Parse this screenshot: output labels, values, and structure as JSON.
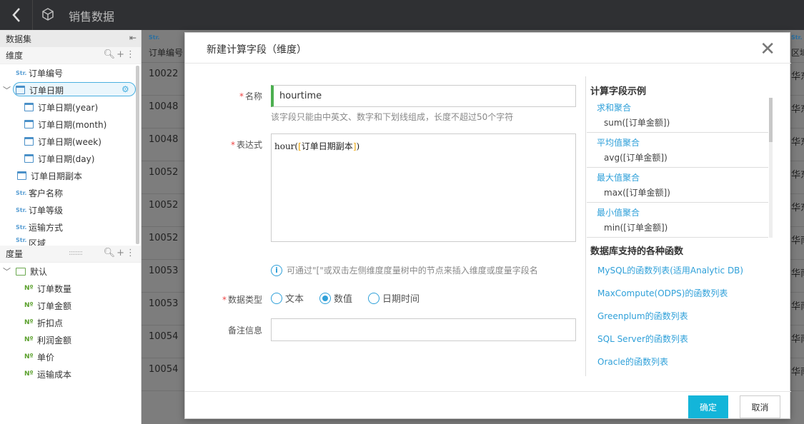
{
  "topbar": {
    "title": "销售数据"
  },
  "left": {
    "dataset_label": "数据集",
    "dimension_label": "维度",
    "dimensions": [
      {
        "tag": "Str.",
        "label": "订单编号"
      },
      {
        "label": "订单日期"
      },
      {
        "label": "订单日期(year)"
      },
      {
        "label": "订单日期(month)"
      },
      {
        "label": "订单日期(week)"
      },
      {
        "label": "订单日期(day)"
      },
      {
        "label": "订单日期副本"
      },
      {
        "tag": "Str.",
        "label": "客户名称"
      },
      {
        "tag": "Str.",
        "label": "订单等级"
      },
      {
        "tag": "Str.",
        "label": "运输方式"
      },
      {
        "tag": "Str.",
        "label": "区域"
      }
    ],
    "measure_label": "度量",
    "measure_folder": "默认",
    "measures": [
      {
        "tag": "Nº",
        "label": "订单数量"
      },
      {
        "tag": "Nº",
        "label": "订单金额"
      },
      {
        "tag": "Nº",
        "label": "折扣点"
      },
      {
        "tag": "Nº",
        "label": "利润金额"
      },
      {
        "tag": "Nº",
        "label": "单价"
      },
      {
        "tag": "Nº",
        "label": "运输成本"
      }
    ]
  },
  "grid": {
    "col1_tag": "Str.",
    "col1_header": "订单编号",
    "col1_values": [
      "10022",
      "10048",
      "10048",
      "10052",
      "10052",
      "10052",
      "10053",
      "10053",
      "10054",
      "10054"
    ],
    "col2_tag": "Str.",
    "col2_header": "区域",
    "col2_values": [
      "华东",
      "华东",
      "华东",
      "华东",
      "华东",
      "华南",
      "华南",
      "华南",
      "华南",
      "华南"
    ]
  },
  "modal": {
    "title": "新建计算字段（维度）",
    "name_label": "名称",
    "name_value": "hourtime",
    "name_hint": "该字段只能由中英文、数字和下划线组成，长度不超过50个字符",
    "expr_label": "表达式",
    "expr_func": "hour(",
    "expr_open": "[",
    "expr_field": "订单日期副本",
    "expr_close": "]",
    "expr_end": ")",
    "info_text": "可通过\"[\"或双击左侧维度度量树中的节点来插入维度或度量字段名",
    "type_label": "数据类型",
    "type_options": [
      "文本",
      "数值",
      "日期时间"
    ],
    "type_selected": "数值",
    "note_label": "备注信息",
    "examples_title": "计算字段示例",
    "examples": [
      {
        "name": "求和聚合",
        "code": "sum([订单金额])"
      },
      {
        "name": "平均值聚合",
        "code": "avg([订单金额])"
      },
      {
        "name": "最大值聚合",
        "code": "max([订单金额])"
      },
      {
        "name": "最小值聚合",
        "code": "min([订单金额])"
      }
    ],
    "functions_title": "数据库支持的各种函数",
    "function_links": [
      "MySQL的函数列表(适用Analytic DB)",
      "MaxCompute(ODPS)的函数列表",
      "Greenplum的函数列表",
      "SQL Server的函数列表",
      "Oracle的函数列表"
    ],
    "ok_label": "确定",
    "cancel_label": "取消"
  }
}
